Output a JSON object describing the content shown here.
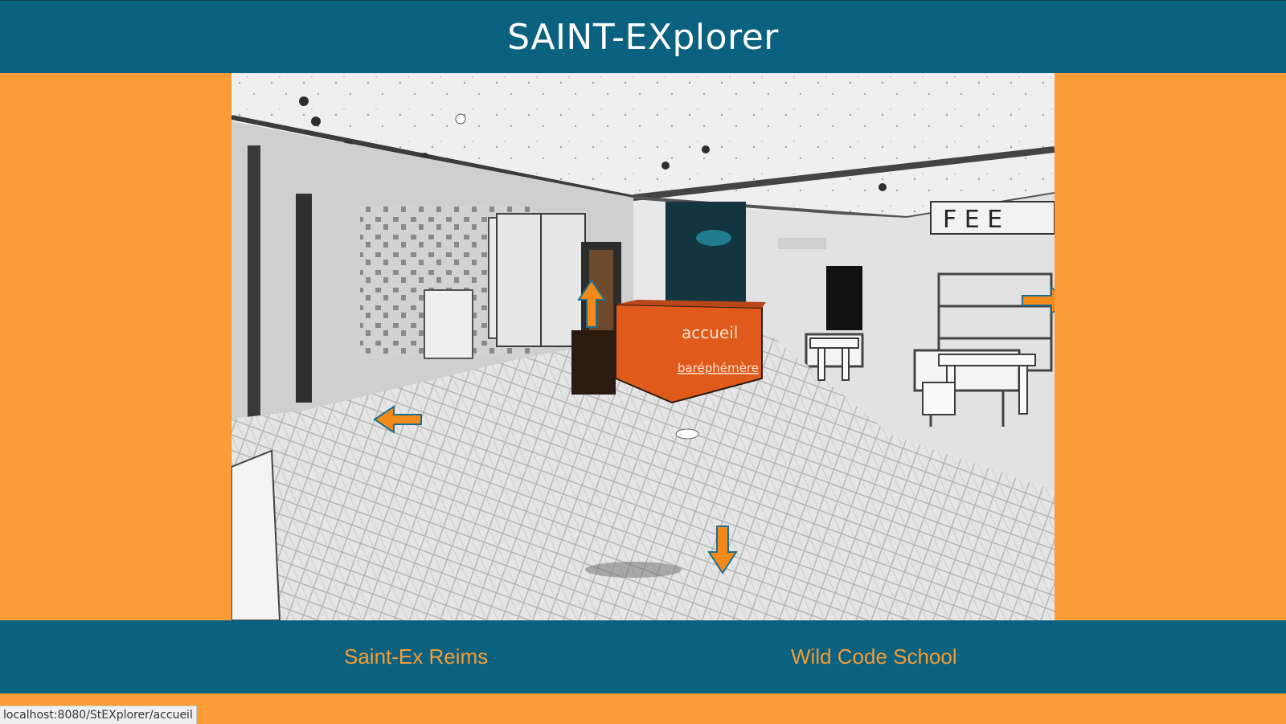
{
  "header": {
    "title": "SAINT-EXplorer"
  },
  "scene": {
    "signs": {
      "counter_top": "accueil",
      "counter_bottom": "baréphémère"
    },
    "arrows": [
      {
        "name": "forward-arrow",
        "icon": "arrow-up-icon"
      },
      {
        "name": "left-arrow",
        "icon": "arrow-left-icon"
      },
      {
        "name": "right-arrow",
        "icon": "arrow-right-icon"
      },
      {
        "name": "back-arrow",
        "icon": "arrow-down-icon"
      }
    ]
  },
  "footer": {
    "links": [
      {
        "label": "Saint-Ex Reims"
      },
      {
        "label": "Wild Code School"
      }
    ]
  },
  "status_bar": {
    "url": "localhost:8080/StEXplorer/accueil"
  },
  "colors": {
    "bar": "#0b6180",
    "background": "#fb9c36",
    "accent": "#f39c34",
    "arrow": "#f28a1a"
  }
}
